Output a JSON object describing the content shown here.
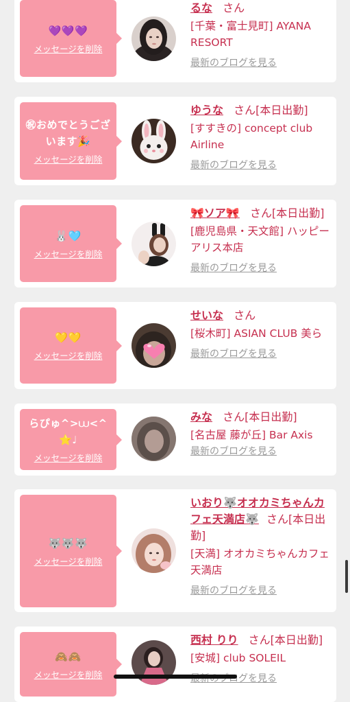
{
  "cards": [
    {
      "message": "💜💜💜",
      "delete_label": "メッセージを削除",
      "name": "るな",
      "suffix": "さん",
      "store": "[千葉・富士見町] AYANA RESORT",
      "blog_label": "最新のブログを見る",
      "avatar": "avatar-woman-dark-hair"
    },
    {
      "message": "㊗おめでとうございます🎉",
      "delete_label": "メッセージを削除",
      "name": "ゆうな",
      "suffix": "さん[本日出勤]",
      "store": "[すすきの] concept club Airline",
      "blog_label": "最新のブログを見る",
      "avatar": "avatar-bunny-face"
    },
    {
      "message": "🐰🩵",
      "delete_label": "メッセージを削除",
      "name": "🎀ソア🎀",
      "suffix": "さん[本日出勤]",
      "store": "[鹿児島県・天文館] ハッピーアリス本店",
      "blog_label": "最新のブログを見る",
      "avatar": "avatar-bunny-ears-woman"
    },
    {
      "message": "💛💛",
      "delete_label": "メッセージを削除",
      "name": "せいな",
      "suffix": "さん",
      "store": "[桜木町] ASIAN CLUB 美ら",
      "blog_label": "最新のブログを見る",
      "avatar": "avatar-heart-covered"
    },
    {
      "message": "らぴゅ^>⩊<^⭐️♩",
      "delete_label": "メッセージを削除",
      "name": "みな",
      "suffix": "さん[本日出勤]",
      "store": "[名古屋 藤が丘] Bar Axis",
      "blog_label": "最新のブログを見る",
      "avatar": "avatar-blurred"
    },
    {
      "message": "🐺🐺🐺",
      "delete_label": "メッセージを削除",
      "name": "いおり🐺オオカミちゃんカフェ天満店🐺",
      "suffix": "さん[本日出勤]",
      "store": "[天満] オオカミちゃんカフェ天満店",
      "blog_label": "最新のブログを見る",
      "avatar": "avatar-woman-selfie"
    },
    {
      "message": "🙈🙈",
      "delete_label": "メッセージを削除",
      "name": "西村 りり",
      "suffix": "さん[本日出勤]",
      "store": "[安城] club SOLEIL",
      "blog_label": "最新のブログを見る",
      "avatar": "avatar-woman-dress"
    }
  ],
  "colors": {
    "bubble": "#f89aa8",
    "accent": "#c62f4f",
    "link_gray": "#9a9a9a",
    "background": "#efefef"
  }
}
